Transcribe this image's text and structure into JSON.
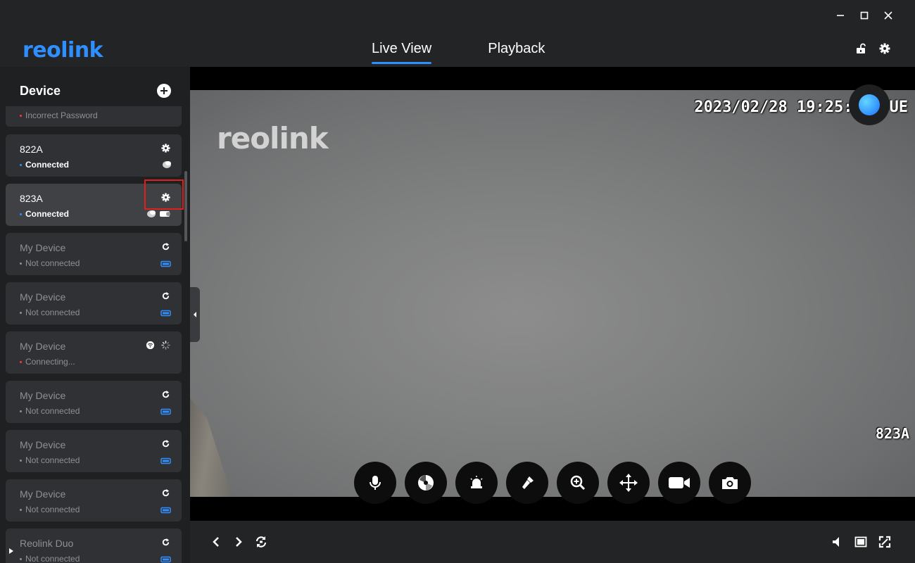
{
  "app": {
    "logo": "reolink"
  },
  "nav": {
    "tabs": [
      {
        "label": "Live View",
        "active": true
      },
      {
        "label": "Playback",
        "active": false
      }
    ]
  },
  "sidebar": {
    "title": "Device",
    "devices": [
      {
        "name": "",
        "status": "Incorrect Password",
        "status_kind": "error"
      },
      {
        "name": "822A",
        "status": "Connected",
        "status_kind": "connected"
      },
      {
        "name": "823A",
        "status": "Connected",
        "status_kind": "connected",
        "selected": true
      },
      {
        "name": "My Device",
        "status": "Not connected",
        "status_kind": "offline"
      },
      {
        "name": "My Device",
        "status": "Not connected",
        "status_kind": "offline"
      },
      {
        "name": "My Device",
        "status": "Connecting...",
        "status_kind": "connecting"
      },
      {
        "name": "My Device",
        "status": "Not connected",
        "status_kind": "offline"
      },
      {
        "name": "My Device",
        "status": "Not connected",
        "status_kind": "offline"
      },
      {
        "name": "My Device",
        "status": "Not connected",
        "status_kind": "offline"
      },
      {
        "name": "Reolink Duo",
        "status": "Not connected",
        "status_kind": "offline"
      }
    ]
  },
  "video": {
    "osd_logo": "reolink",
    "timestamp": "2023/02/28 19:25:",
    "timestamp_suffix": "UE",
    "camera_name": "823A"
  },
  "controls": [
    "microphone-icon",
    "lens-icon",
    "siren-icon",
    "spotlight-icon",
    "zoom-icon",
    "ptz-move-icon",
    "record-icon",
    "snapshot-icon"
  ],
  "colors": {
    "accent": "#2f8fff",
    "background": "#232426",
    "sidebar": "#1f2022",
    "card": "#303134",
    "card_selected": "#404144",
    "error": "#ff3b30",
    "highlight": "#e0201a"
  }
}
